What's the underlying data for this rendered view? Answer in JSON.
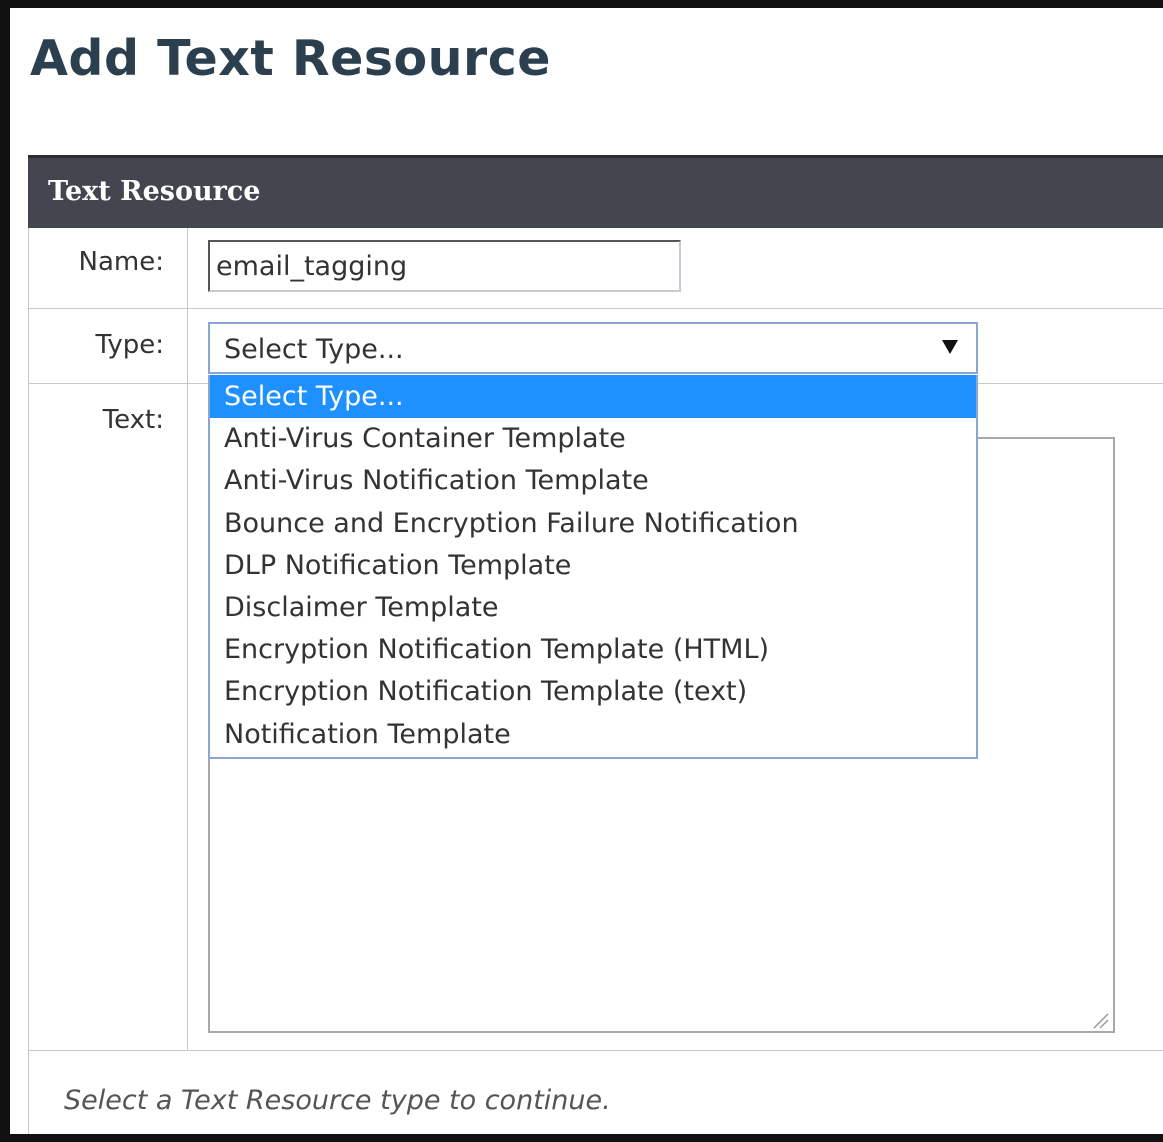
{
  "page": {
    "title": "Add Text Resource"
  },
  "section": {
    "title": "Text Resource"
  },
  "form": {
    "name_label": "Name:",
    "name_value": "email_tagging",
    "type_label": "Type:",
    "type_value": "Select Type...",
    "text_label": "Text:",
    "text_value": ""
  },
  "type_options": [
    "Select Type...",
    "Anti-Virus Container Template",
    "Anti-Virus Notification Template",
    "Bounce and Encryption Failure Notification",
    "DLP Notification Template",
    "Disclaimer Template",
    "Encryption Notification Template (HTML)",
    "Encryption Notification Template (text)",
    "Notification Template"
  ],
  "selected_option_index": 0,
  "footer": {
    "help_text": "Select a Text Resource type to continue."
  },
  "colors": {
    "title": "#2b3f4f",
    "section_header_bg": "#44464f",
    "option_highlight": "#1e90ff",
    "select_border": "#8aa6d6"
  },
  "icons": {
    "dropdown_arrow": "chevron-down-icon",
    "textarea_resize": "resize-grip-icon"
  }
}
